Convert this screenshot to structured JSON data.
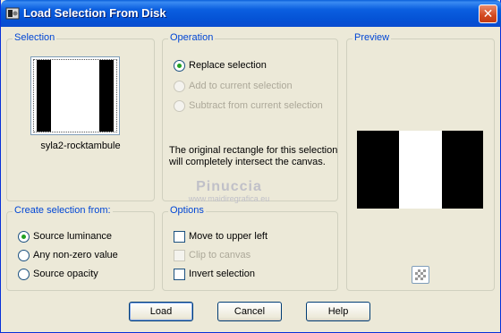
{
  "window": {
    "title": "Load Selection From Disk",
    "close_glyph": "✕"
  },
  "selection": {
    "title": "Selection",
    "file_name": "syla2-rocktambule"
  },
  "operation": {
    "title": "Operation",
    "options": [
      {
        "label": "Replace selection",
        "checked": true,
        "disabled": false
      },
      {
        "label": "Add to current selection",
        "checked": false,
        "disabled": true
      },
      {
        "label": "Subtract from current selection",
        "checked": false,
        "disabled": true
      }
    ],
    "info_line1": "The original rectangle for this selection",
    "info_line2": "will completely intersect the canvas."
  },
  "preview": {
    "title": "Preview"
  },
  "create_from": {
    "title": "Create selection from:",
    "options": [
      {
        "label": "Source luminance",
        "checked": true
      },
      {
        "label": "Any non-zero value",
        "checked": false
      },
      {
        "label": "Source opacity",
        "checked": false
      }
    ]
  },
  "options": {
    "title": "Options",
    "items": [
      {
        "label": "Move to upper left",
        "checked": false,
        "disabled": false
      },
      {
        "label": "Clip to canvas",
        "checked": false,
        "disabled": true
      },
      {
        "label": "Invert selection",
        "checked": false,
        "disabled": false
      }
    ]
  },
  "buttons": {
    "load": "Load",
    "cancel": "Cancel",
    "help": "Help"
  },
  "watermark": {
    "line1": "Pinuccia",
    "line2": "www.maidiregrafica.eu"
  },
  "colors": {
    "accent": "#0046d5",
    "titlebar": "#0553d6",
    "dialog_bg": "#ece9d8",
    "radio_dot": "#21a121"
  }
}
